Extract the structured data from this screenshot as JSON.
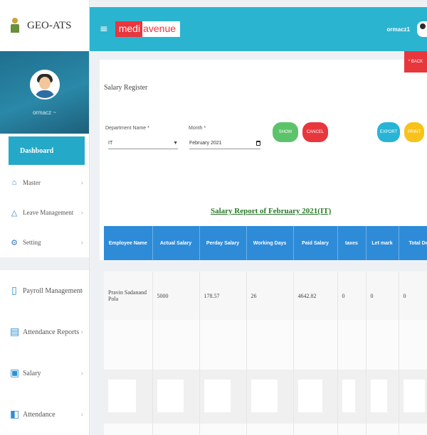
{
  "app": {
    "name": "GEO-ATS",
    "user": "ormacz ~"
  },
  "sidebar": {
    "active": "Dashboard",
    "items": [
      {
        "label": "Master",
        "icon": "home-icon"
      },
      {
        "label": "Leave Management",
        "icon": "warning-icon"
      },
      {
        "label": "Setting",
        "icon": "gear-icon"
      },
      {
        "label": "Payroll Management",
        "icon": "document-icon"
      },
      {
        "label": "Attendance Reports",
        "icon": "report-icon"
      },
      {
        "label": "Salary",
        "icon": "money-icon"
      },
      {
        "label": "Attendance",
        "icon": "attendance-icon"
      }
    ]
  },
  "topbar": {
    "logo_a": "medi",
    "logo_b": "avenue",
    "user": "ormacz1"
  },
  "page": {
    "title": "Salary Register",
    "back_label": "* BACK",
    "department_label": "Department Name *",
    "department_value": "IT",
    "month_label": "Month *",
    "month_value": "February 2021",
    "show_label": "SHOW",
    "cancel_label": "CANCEL",
    "export_label": "EXPORT",
    "print_label": "PRINT",
    "report_title": "Salary Report of February 2021(IT)"
  },
  "table": {
    "headers": [
      "Employee Name",
      "Actual Salary",
      "Perday Salary",
      "Working Days",
      "Paid Salary",
      "taxes",
      "Let mark",
      "Total De"
    ],
    "rows": [
      [
        "Pravin Sadanand Pola",
        "5000",
        "178.57",
        "26",
        "4642.82",
        "0",
        "0",
        "0"
      ]
    ]
  },
  "colors": {
    "topbar": "#2bb4d0",
    "active_nav": "#25a9c8",
    "table_header": "#2e8bd8",
    "show_btn": "#5cc36a",
    "cancel_btn": "#e8363d",
    "export_btn": "#27b4d6",
    "print_btn": "#f7c21a",
    "report_title": "#2a7a2a"
  }
}
